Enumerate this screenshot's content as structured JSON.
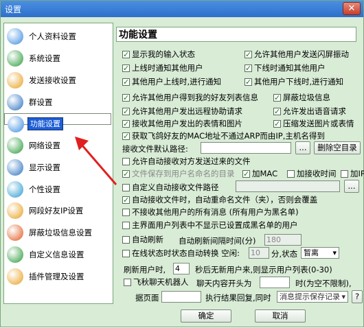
{
  "window": {
    "title": "设置",
    "close_label": "✕"
  },
  "sidebar": {
    "items": [
      {
        "label": "个人资料设置",
        "icon": "person-icon",
        "color": "#3a8be0"
      },
      {
        "label": "系统设置",
        "icon": "system-icon",
        "color": "#2a9a3a"
      },
      {
        "label": "发送接收设置",
        "icon": "send-receive-icon",
        "color": "#e8a020"
      },
      {
        "label": "群设置",
        "icon": "group-icon",
        "color": "#2a70c0"
      },
      {
        "label": "功能设置",
        "icon": "function-icon",
        "color": "#3a8be0"
      },
      {
        "label": "网络设置",
        "icon": "network-icon",
        "color": "#2a9a3a"
      },
      {
        "label": "显示设置",
        "icon": "display-icon",
        "color": "#2a70c0"
      },
      {
        "label": "个性设置",
        "icon": "personality-icon",
        "color": "#2a9ad0"
      },
      {
        "label": "网段好友IP设置",
        "icon": "ip-icon",
        "color": "#e8a020"
      },
      {
        "label": "屏蔽垃圾信息设置",
        "icon": "block-spam-icon",
        "color": "#e05a20"
      },
      {
        "label": "自定义信息设置",
        "icon": "custom-info-icon",
        "color": "#2a9a3a"
      },
      {
        "label": "插件管理及设置",
        "icon": "plugin-icon",
        "color": "#e8a020"
      }
    ]
  },
  "panel": {
    "title": "功能设置",
    "c1": "显示我的输入状态",
    "c2": "允许其他用户发送闪屏振动",
    "c3": "上线时通知其他用户",
    "c4": "下线时通知其他用户",
    "c5": "其他用户上线时,进行通知",
    "c6": "其他用户下线时,进行通知",
    "c7": "允许其他用户得到我的好友列表信息",
    "c8": "屏蔽垃圾信息",
    "c9": "允许其他用户发出远程协助请求",
    "c10": "允许发出语音请求",
    "c11": "接收其他用户发出的表情和图片",
    "c12": "压缩发送图片或表情",
    "c13": "获取飞鸽好友的MAC地址不通过ARP而由IP,主机名得到",
    "recv_path_label": "接收文件默认路径:",
    "browse": "...",
    "delete_empty": "删除空目录",
    "c14": "允许自动接收对方发送过来的文件",
    "c15": "文件保存到用户名命名的目录",
    "c16": "加MAC",
    "c17": "加接收时间",
    "c18": "加IP",
    "c19": "自定义自动接收文件路径",
    "c20": "自动接收文件时，自动重命名文件（夹），否则会覆盖",
    "c21": "不接收其他用户的所有消息 (所有用户为黑名单)",
    "c22": "主界面用户列表中不显示已设置成黑名单的用户",
    "c23": "自动刷新",
    "refresh_interval_label": "自动刷新间隔时间(分)",
    "refresh_interval": "180",
    "c24": "在线状态时状态自动转换 空闲:",
    "idle_value": "10",
    "idle_unit": "分,状态",
    "idle_status": "暂离",
    "refresh_users_label": "刷新用户时,",
    "refresh_users_value": "4",
    "refresh_users_suffix": "秒后无新用户来,则显示用户列表(0-30)",
    "c25": "飞秋聊天机器人",
    "chat_prefix_label": "聊天内容开头为",
    "chat_prefix_suffix": "时(为空不限制),",
    "page_label": "据页面",
    "exec_label": "执行结果回复,同时",
    "msg_select": "消息提示保存记录",
    "help": "?",
    "ok": "确定",
    "cancel": "取消"
  },
  "colors": {
    "accent": "#1e5fd6",
    "bg": "#d8ecd6",
    "arrow": "#e02020"
  }
}
